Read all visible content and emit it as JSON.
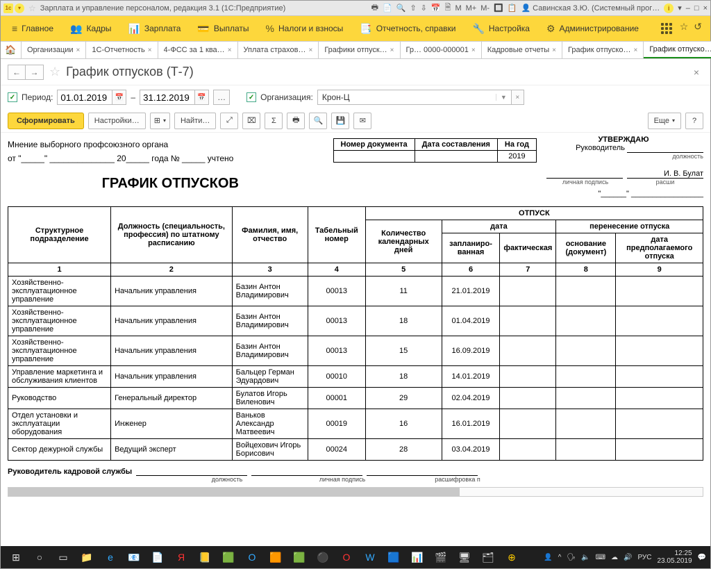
{
  "titlebar": {
    "app_id": "1c",
    "title": "Зарплата и управление персоналом, редакция 3.1  (1С:Предприятие)",
    "tools": [
      "🖶",
      "📄",
      "🔍",
      "⇧",
      "⇩",
      "📅",
      "🗎",
      "M",
      "M+",
      "M-",
      "🔲",
      "📋"
    ],
    "user": "Савинская З.Ю. (Системный прог…",
    "info": "i",
    "min": "–",
    "max": "□",
    "close": "×"
  },
  "menubar": {
    "items": [
      {
        "icon": "≡",
        "label": "Главное"
      },
      {
        "icon": "👥",
        "label": "Кадры"
      },
      {
        "icon": "📊",
        "label": "Зарплата"
      },
      {
        "icon": "💳",
        "label": "Выплаты"
      },
      {
        "icon": "%",
        "label": "Налоги и взносы"
      },
      {
        "icon": "📑",
        "label": "Отчетность, справки"
      },
      {
        "icon": "🔧",
        "label": "Настройка"
      },
      {
        "icon": "⚙",
        "label": "Администрирование"
      }
    ]
  },
  "doctabs": [
    {
      "label": "Организации",
      "closable": true
    },
    {
      "label": "1С-Отчетность",
      "closable": true
    },
    {
      "label": "4-ФСС за 1 ква…",
      "closable": true
    },
    {
      "label": "Уплата страхов…",
      "closable": true
    },
    {
      "label": "Графики отпуск…",
      "closable": true
    },
    {
      "label": "Гр… 0000-000001",
      "closable": true
    },
    {
      "label": "Кадровые отчеты",
      "closable": true
    },
    {
      "label": "График отпуско…",
      "closable": true
    },
    {
      "label": "График отпуско…",
      "closable": true,
      "active": true
    }
  ],
  "page": {
    "back": "←",
    "fwd": "→",
    "star": "☆",
    "title": "График отпусков (Т-7)"
  },
  "filters": {
    "period_label": "Период:",
    "date_from": "01.01.2019",
    "dash": "–",
    "date_to": "31.12.2019",
    "dots": "…",
    "org_label": "Организация:",
    "org_value": "Крон-Ц"
  },
  "toolbar": {
    "generate": "Сформировать",
    "settings": "Настройки…",
    "find": "Найти…",
    "more": "Еще",
    "help": "?",
    "icons": {
      "table": "⊞",
      "expand": "⤢",
      "tree": "⌧",
      "sum": "Σ",
      "print": "🖶",
      "preview": "🔍",
      "save": "💾",
      "mail": "✉"
    }
  },
  "report": {
    "union_opinion": "Мнение выборного профсоюзного органа",
    "from": "от",
    "year": "20",
    "year_word": "года",
    "num": "№",
    "accounted": "учтено",
    "title": "ГРАФИК ОТПУСКОВ",
    "approve": "УТВЕРЖДАЮ",
    "head": "Руководитель",
    "position_cap": "должность",
    "sign_cap": "личная подпись",
    "decode_cap": "расши",
    "signer": "И. В. Булат",
    "docnum_hdr": "Номер документа",
    "docdate_hdr": "Дата составления",
    "docyear_hdr": "На год",
    "docyear_val": "2019",
    "cols": {
      "c1": "Структурное подразделение",
      "c2": "Должность (специальность, профессия) по штатному расписанию",
      "c3": "Фамилия, имя, отчество",
      "c4": "Табельный номер",
      "c5g": "ОТПУСК",
      "c5": "Количество календарных дней",
      "c6g": "дата",
      "c6": "запланиро-\nванная",
      "c7": "фактическая",
      "c8g": "перенесение отпуска",
      "c8": "основание (документ)",
      "c9": "дата предполагаемого отпуска"
    },
    "nums": {
      "n1": "1",
      "n2": "2",
      "n3": "3",
      "n4": "4",
      "n5": "5",
      "n6": "6",
      "n7": "7",
      "n8": "8",
      "n9": "9"
    },
    "rows": [
      {
        "dep": "Хозяйственно-эксплуатационное управление",
        "pos": "Начальник управления",
        "fio": "Базин Антон Владимирович",
        "tab": "00013",
        "days": "11",
        "plan": "21.01.2019"
      },
      {
        "dep": "Хозяйственно-эксплуатационное управление",
        "pos": "Начальник управления",
        "fio": "Базин Антон Владимирович",
        "tab": "00013",
        "days": "18",
        "plan": "01.04.2019"
      },
      {
        "dep": "Хозяйственно-эксплуатационное управление",
        "pos": "Начальник управления",
        "fio": "Базин Антон Владимирович",
        "tab": "00013",
        "days": "15",
        "plan": "16.09.2019"
      },
      {
        "dep": "Управление маркетинга и обслуживания клиентов",
        "pos": "Начальник управления",
        "fio": "Бальцер Герман Эдуардович",
        "tab": "00010",
        "days": "18",
        "plan": "14.01.2019"
      },
      {
        "dep": "Руководство",
        "pos": "Генеральный директор",
        "fio": "Булатов Игорь Виленович",
        "tab": "00001",
        "days": "29",
        "plan": "02.04.2019"
      },
      {
        "dep": "Отдел установки и эксплуатации оборудования",
        "pos": "Инженер",
        "fio": "Ваньков Александр Матвеевич",
        "tab": "00019",
        "days": "16",
        "plan": "16.01.2019"
      },
      {
        "dep": "Сектор дежурной службы",
        "pos": "Ведущий эксперт",
        "fio": "Войцехович Игорь Борисович",
        "tab": "00024",
        "days": "28",
        "plan": "03.04.2019"
      }
    ],
    "hr_head": "Руководитель кадровой службы",
    "cap_pos": "должность",
    "cap_sign": "личная подпись",
    "cap_dec": "расшифровка  п"
  },
  "taskbar": {
    "icons": [
      "⊞",
      "○",
      "▭",
      "📁",
      "e",
      "📧",
      "📄",
      "Я",
      "📒",
      "🟩",
      "O",
      "🟧",
      "🟩",
      "⚫",
      "O",
      "W",
      "🟦",
      "📊",
      "🎬",
      "🖥",
      "🗂",
      "⊕"
    ],
    "tray": [
      "👤",
      "^",
      "🗣",
      "🔈",
      "⌨",
      "☁",
      "🔊"
    ],
    "lang": "РУС",
    "time": "12:25",
    "date": "23.05.2019"
  }
}
